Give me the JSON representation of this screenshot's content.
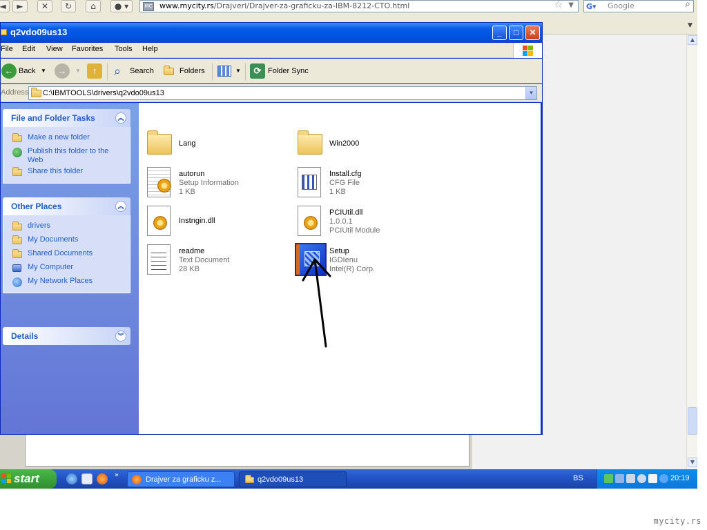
{
  "browser": {
    "url_host": "www.mycity.rs",
    "url_path": "/Drajveri/Drajver-za-graficku-za-IBM-8212-CTO.html",
    "search_placeholder": "Google"
  },
  "window": {
    "title": "q2vdo09us13",
    "menu": [
      "File",
      "Edit",
      "View",
      "Favorites",
      "Tools",
      "Help"
    ],
    "toolbar": {
      "back": "Back",
      "search": "Search",
      "folders": "Folders",
      "folder_sync": "Folder Sync"
    },
    "address_label": "Address",
    "address_value": "C:\\IBMTOOLS\\drivers\\q2vdo09us13"
  },
  "taskpane": {
    "file_tasks": {
      "title": "File and Folder Tasks",
      "items": [
        "Make a new folder",
        "Publish this folder to the Web",
        "Share this folder"
      ]
    },
    "other_places": {
      "title": "Other Places",
      "items": [
        "drivers",
        "My Documents",
        "Shared Documents",
        "My Computer",
        "My Network Places"
      ]
    },
    "details": {
      "title": "Details"
    }
  },
  "files": [
    {
      "name": "Lang",
      "type": "",
      "detail": ""
    },
    {
      "name": "Win2000",
      "type": "",
      "detail": ""
    },
    {
      "name": "autorun",
      "type": "Setup Information",
      "detail": "1 KB"
    },
    {
      "name": "Install.cfg",
      "type": "CFG File",
      "detail": "1 KB"
    },
    {
      "name": "Instngin.dll",
      "type": "",
      "detail": ""
    },
    {
      "name": "PCIUtil.dll",
      "type": "1.0.0.1",
      "detail": "PCIUtil Module"
    },
    {
      "name": "readme",
      "type": "Text Document",
      "detail": "28 KB"
    },
    {
      "name": "Setup",
      "type": "IGDIenu",
      "detail": "Intel(R) Corp."
    }
  ],
  "taskbar": {
    "start": "start",
    "tasks": [
      "Drajver za graficku z...",
      "q2vdo09us13"
    ],
    "lang": "BS",
    "clock": "20:19"
  },
  "watermark": "mycity.rs",
  "colors": {
    "xp_blue": "#0054e3",
    "pane_link": "#215dc6",
    "taskbar": "#2456c9",
    "start_green": "#3c9c3c"
  }
}
